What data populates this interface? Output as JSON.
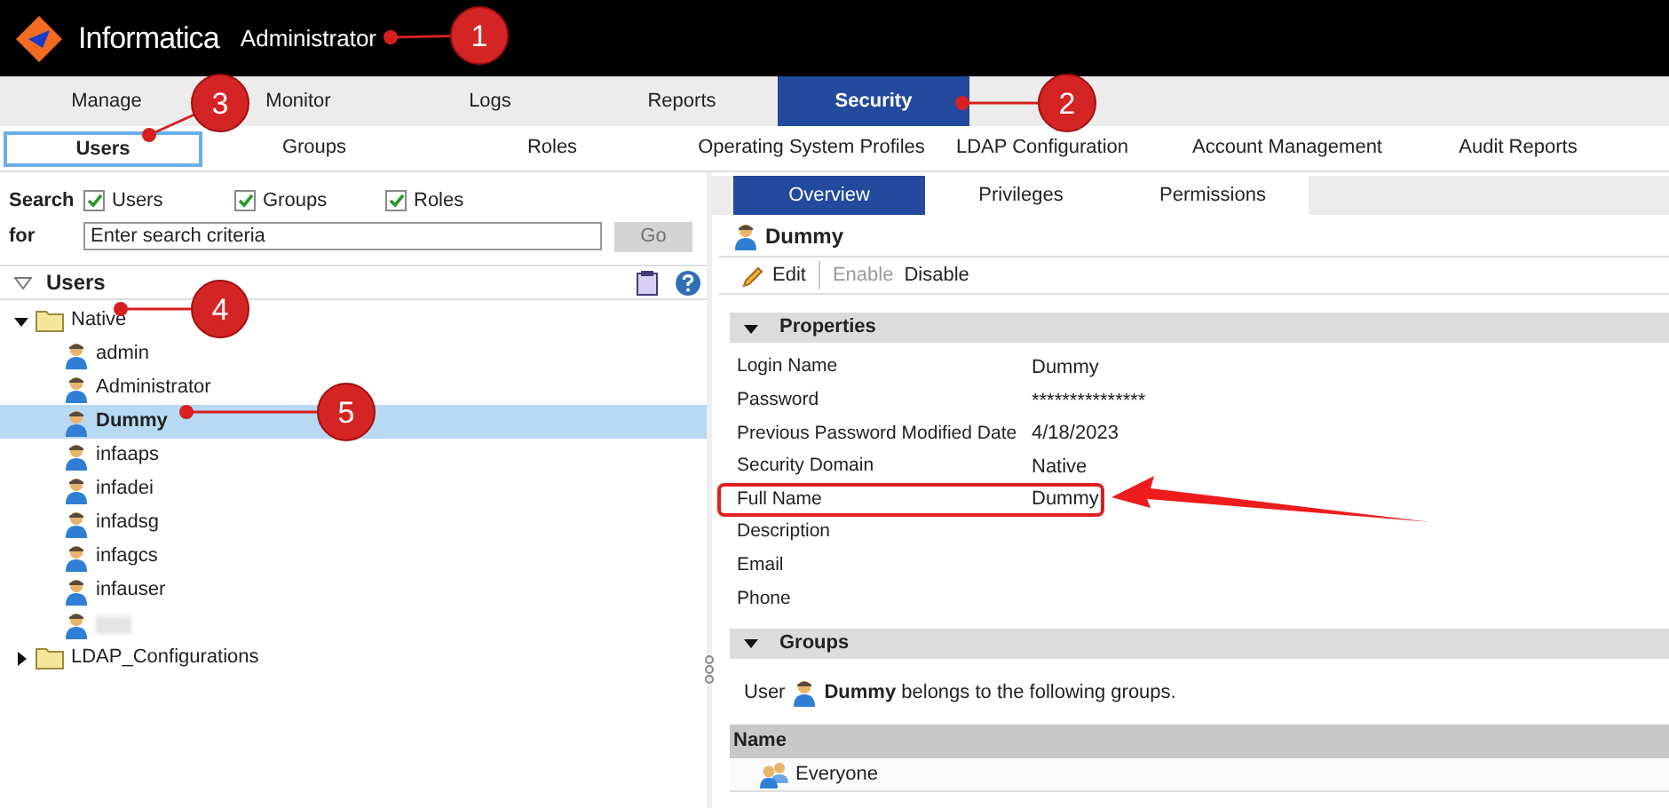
{
  "header": {
    "brand": "Informatica",
    "product": "Administrator"
  },
  "main_tabs": [
    {
      "label": "Manage",
      "selected": false
    },
    {
      "label": "Monitor",
      "selected": false
    },
    {
      "label": "Logs",
      "selected": false
    },
    {
      "label": "Reports",
      "selected": false
    },
    {
      "label": "Security",
      "selected": true
    }
  ],
  "sub_tabs": [
    {
      "label": "Users",
      "selected": true
    },
    {
      "label": "Groups",
      "selected": false
    },
    {
      "label": "Roles",
      "selected": false
    },
    {
      "label": "Operating System Profiles",
      "selected": false
    },
    {
      "label": "LDAP Configuration",
      "selected": false
    },
    {
      "label": "Account Management",
      "selected": false
    },
    {
      "label": "Audit Reports",
      "selected": false
    }
  ],
  "search": {
    "label": "Search",
    "for_label": "for",
    "filters": [
      {
        "label": "Users",
        "checked": true
      },
      {
        "label": "Groups",
        "checked": true
      },
      {
        "label": "Roles",
        "checked": true
      }
    ],
    "placeholder": "Enter search criteria",
    "button": {
      "label": "Go",
      "disabled": true
    }
  },
  "navigator": {
    "title": "Users",
    "tree": [
      {
        "kind": "folder",
        "label": "Native",
        "expanded": true,
        "selected": false,
        "children": [
          {
            "kind": "user",
            "label": "admin",
            "selected": false
          },
          {
            "kind": "user",
            "label": "Administrator",
            "selected": false
          },
          {
            "kind": "user",
            "label": "Dummy",
            "selected": true
          },
          {
            "kind": "user",
            "label": "infaaps",
            "selected": false
          },
          {
            "kind": "user",
            "label": "infadei",
            "selected": false
          },
          {
            "kind": "user",
            "label": "infadsg",
            "selected": false
          },
          {
            "kind": "user",
            "label": "infagcs",
            "selected": false
          },
          {
            "kind": "user",
            "label": "infauser",
            "selected": false
          },
          {
            "kind": "redacted_user",
            "selected": false
          }
        ]
      },
      {
        "kind": "folder",
        "label": "LDAP_Configurations",
        "expanded": false,
        "selected": false
      }
    ]
  },
  "detail": {
    "tabs": [
      {
        "label": "Overview",
        "selected": true
      },
      {
        "label": "Privileges",
        "selected": false
      },
      {
        "label": "Permissions",
        "selected": false
      }
    ],
    "title": "Dummy",
    "toolbar": [
      {
        "kind": "edit",
        "label": "Edit",
        "disabled": false
      },
      {
        "kind": "plain",
        "label": "Enable",
        "disabled": true
      },
      {
        "kind": "plain",
        "label": "Disable",
        "disabled": false
      }
    ],
    "properties": {
      "title": "Properties",
      "expanded": true,
      "rows": [
        {
          "label": "Login Name",
          "value": "Dummy",
          "highlighted": false
        },
        {
          "label": "Password",
          "value": "***************",
          "highlighted": false
        },
        {
          "label": "Previous Password Modified Date",
          "value": "4/18/2023",
          "highlighted": false
        },
        {
          "label": "Security Domain",
          "value": "Native",
          "highlighted": false
        },
        {
          "label": "Full Name",
          "value": "Dummy",
          "highlighted": true
        },
        {
          "label": "Description",
          "highlighted": false
        },
        {
          "label": "Email",
          "highlighted": false
        },
        {
          "label": "Phone",
          "highlighted": false
        }
      ]
    },
    "groups": {
      "title": "Groups",
      "expanded": true,
      "prefix": "User",
      "sentence": "**Dummy** belongs to the following groups.",
      "column": "Name",
      "rows": [
        "Everyone"
      ]
    }
  },
  "annotations": [
    {
      "label": "1"
    },
    {
      "label": "2"
    },
    {
      "label": "3"
    },
    {
      "label": "4"
    },
    {
      "label": "5"
    }
  ]
}
